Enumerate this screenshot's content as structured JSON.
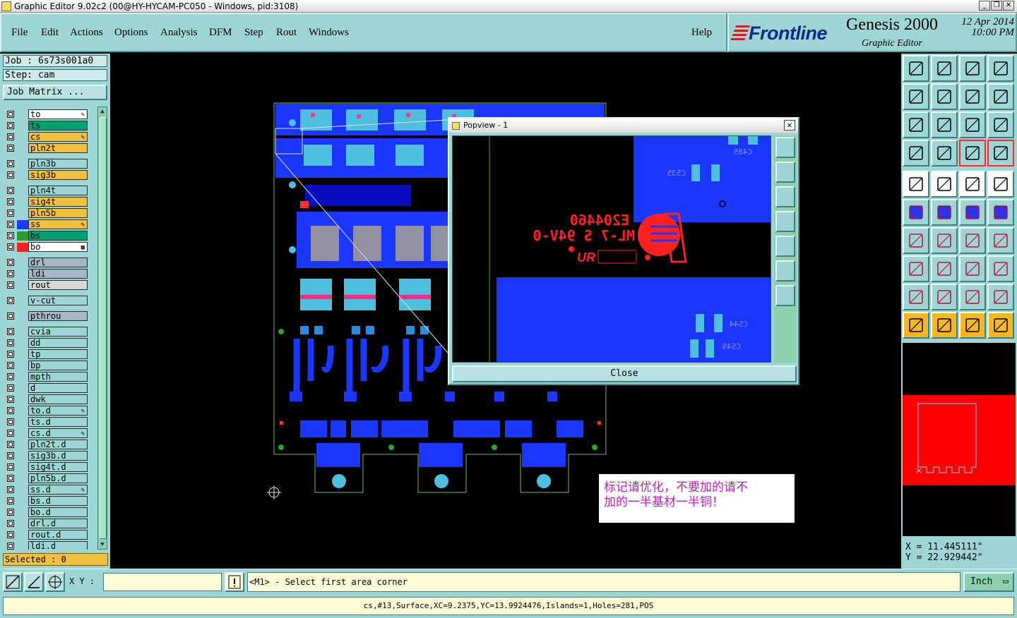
{
  "window": {
    "title": "Graphic Editor 9.02c2 (00@HY-HYCAM-PC050 - Windows, pid:3108)",
    "controls": [
      "_",
      "❐",
      "✕"
    ]
  },
  "menu": {
    "items": [
      "File",
      "Edit",
      "Actions",
      "Options",
      "Analysis",
      "DFM",
      "Step",
      "Rout",
      "Windows"
    ],
    "help": "Help"
  },
  "brand": {
    "logo": "Frontline",
    "product": "Genesis 2000",
    "subtitle": "Graphic Editor",
    "date": "12 Apr 2014",
    "time": "10:00 PM"
  },
  "job": {
    "job_label": "Job : 6s73s001a0",
    "step_label": "Step: cam",
    "matrix_button": "Job Matrix ..."
  },
  "layers": [
    {
      "name": "to",
      "bg": "#ffffff",
      "swatch": "",
      "mark": "✎"
    },
    {
      "name": "ts",
      "bg": "#00a070",
      "swatch": "",
      "mark": ""
    },
    {
      "name": "cs",
      "bg": "#f0c040",
      "swatch": "",
      "mark": "✎"
    },
    {
      "name": "pln2t",
      "bg": "#f0c040",
      "swatch": "",
      "mark": ""
    },
    {
      "name": "pln3b",
      "bg": "#9ed6d6",
      "swatch": "",
      "mark": ""
    },
    {
      "name": "sig3b",
      "bg": "#f0c040",
      "swatch": "",
      "mark": ""
    },
    {
      "name": "pln4t",
      "bg": "#9ed6d6",
      "swatch": "",
      "mark": ""
    },
    {
      "name": "sig4t",
      "bg": "#f0c040",
      "swatch": "",
      "mark": ""
    },
    {
      "name": "pln5b",
      "bg": "#f0c040",
      "swatch": "",
      "mark": ""
    },
    {
      "name": "ss",
      "bg": "#f0c040",
      "swatch": "#1e3cff",
      "mark": "✎"
    },
    {
      "name": "bs",
      "bg": "#00a070",
      "swatch": "#2a9a2a",
      "mark": ""
    },
    {
      "name": "bo",
      "bg": "#ffffff",
      "swatch": "#ff2020",
      "mark": "▦"
    },
    {
      "name": "drl",
      "bg": "#a6b8c4",
      "swatch": "",
      "mark": ""
    },
    {
      "name": "ldi",
      "bg": "#a6b8c4",
      "swatch": "",
      "mark": ""
    },
    {
      "name": "rout",
      "bg": "#d8d8d8",
      "swatch": "",
      "mark": ""
    },
    {
      "name": "v-cut",
      "bg": "#9ed6d6",
      "swatch": "",
      "mark": ""
    },
    {
      "name": "pthrou",
      "bg": "#a6b8c4",
      "swatch": "",
      "mark": ""
    },
    {
      "name": "cvia",
      "bg": "#9ed6d6",
      "swatch": "",
      "mark": ""
    },
    {
      "name": "dd",
      "bg": "#9ed6d6",
      "swatch": "",
      "mark": ""
    },
    {
      "name": "tp",
      "bg": "#9ed6d6",
      "swatch": "",
      "mark": ""
    },
    {
      "name": "bp",
      "bg": "#9ed6d6",
      "swatch": "",
      "mark": ""
    },
    {
      "name": "mpth",
      "bg": "#9ed6d6",
      "swatch": "",
      "mark": ""
    },
    {
      "name": "d",
      "bg": "#9ed6d6",
      "swatch": "",
      "mark": ""
    },
    {
      "name": "dwk",
      "bg": "#9ed6d6",
      "swatch": "",
      "mark": ""
    },
    {
      "name": "to.d",
      "bg": "#9ed6d6",
      "swatch": "",
      "mark": "✎"
    },
    {
      "name": "ts.d",
      "bg": "#9ed6d6",
      "swatch": "",
      "mark": ""
    },
    {
      "name": "cs.d",
      "bg": "#9ed6d6",
      "swatch": "",
      "mark": "✎"
    },
    {
      "name": "pln2t.d",
      "bg": "#9ed6d6",
      "swatch": "",
      "mark": ""
    },
    {
      "name": "sig3b.d",
      "bg": "#9ed6d6",
      "swatch": "",
      "mark": ""
    },
    {
      "name": "sig4t.d",
      "bg": "#9ed6d6",
      "swatch": "",
      "mark": ""
    },
    {
      "name": "pln5b.d",
      "bg": "#9ed6d6",
      "swatch": "",
      "mark": ""
    },
    {
      "name": "ss.d",
      "bg": "#9ed6d6",
      "swatch": "",
      "mark": "✎"
    },
    {
      "name": "bs.d",
      "bg": "#9ed6d6",
      "swatch": "",
      "mark": ""
    },
    {
      "name": "bo.d",
      "bg": "#9ed6d6",
      "swatch": "",
      "mark": ""
    },
    {
      "name": "drl.d",
      "bg": "#9ed6d6",
      "swatch": "",
      "mark": ""
    },
    {
      "name": "rout.d",
      "bg": "#9ed6d6",
      "swatch": "",
      "mark": ""
    },
    {
      "name": "ldi.d",
      "bg": "#9ed6d6",
      "swatch": "",
      "mark": ""
    }
  ],
  "selected_label": "Selected : 0",
  "popview": {
    "title": "Popview - 1",
    "close_label": "Close",
    "texts": [
      "E204460",
      "ML-7 S 94V-0",
      "C485",
      "C535",
      "C544",
      "C549"
    ]
  },
  "note": {
    "line1": "标记请优化，不要加的请不",
    "line2": "加的一半基材一半铜！"
  },
  "tools": [
    [
      "home-up-icon",
      "board-down-icon",
      "home-icon",
      "split-window-icon"
    ],
    [
      "panel-left-icon",
      "panel-right-icon",
      "undo-icon",
      "redo-icon"
    ],
    [
      "fit-screen-icon",
      "center-icon",
      "scale-1-2-icon",
      "help-query-icon"
    ],
    [
      "measure-icon",
      "grid-icon",
      "layers-red-icon",
      "layers-red2-icon"
    ],
    [
      "add-feature-icon",
      "edit-line-icon",
      "ruler-icon",
      "dashed-box-icon"
    ],
    [
      "connect-icon",
      "cross-icon",
      "move-node-icon",
      "drag-icon"
    ],
    [
      "angle-icon",
      "slash-icon",
      "arc-icon",
      "mirror-icon"
    ],
    [
      "select-dot-icon",
      "split-icon",
      "resize-icon",
      "copy-icon"
    ],
    [
      "triangle-icon",
      "triangle-fill-icon",
      "triangle-a-icon",
      "triangle-b-icon"
    ],
    [
      "pointer-icon",
      "pointer-box-icon",
      "pointer-alt-icon",
      "route-icon"
    ]
  ],
  "coords": {
    "x": "X = 11.445111\"",
    "y": "Y = 22.929442\""
  },
  "cmd": {
    "xy_label": "X Y :",
    "xy_value": "",
    "status": "<M1> - Select first area corner",
    "unit": "Inch"
  },
  "info": "cs,#13,Surface,XC=9.2375,YC=13.9924476,Islands=1,Holes=281,POS"
}
